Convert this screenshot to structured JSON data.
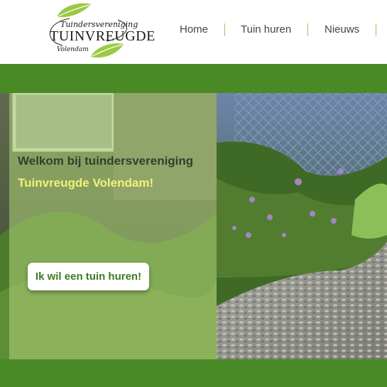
{
  "logo": {
    "line1": "Tuindersvereniging",
    "line2": "TUINVREUGDE",
    "line3": "Volendam"
  },
  "nav": {
    "items": [
      {
        "label": "Home"
      },
      {
        "label": "Tuin huren"
      },
      {
        "label": "Nieuws"
      }
    ]
  },
  "hero": {
    "welcome": "Welkom bij tuindersvereniging",
    "club_name": "Tuinvreugde Volendam!",
    "cta_label": "Ik wil een tuin huren!"
  },
  "colors": {
    "brand_green": "#4a8a26",
    "nav_separator": "#9bc66a",
    "accent_yellow": "#f1f27a",
    "cta_text": "#3d7a22"
  },
  "icons": [
    "leaf-icon"
  ]
}
